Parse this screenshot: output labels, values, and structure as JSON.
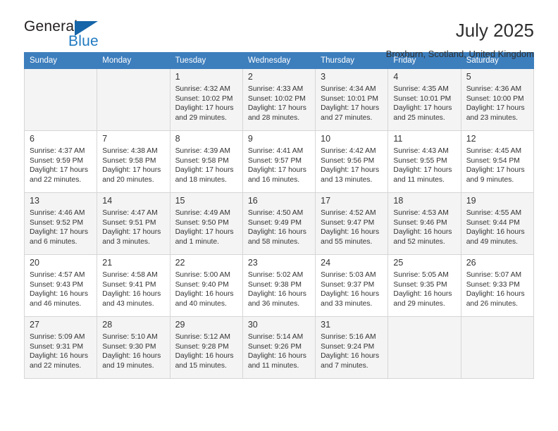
{
  "brand": {
    "name_top": "General",
    "name_bottom": "Blue",
    "triangle_color": "#1565a8",
    "blue_text_color": "#1f7ac0"
  },
  "header": {
    "title": "July 2025",
    "location": "Broxburn, Scotland, United Kingdom"
  },
  "theme": {
    "header_row_bg": "#3d7ebd",
    "header_row_text": "#ffffff",
    "alt_row_bg": "#f4f4f4",
    "cell_border": "#d6d6d6"
  },
  "weekdays": [
    "Sunday",
    "Monday",
    "Tuesday",
    "Wednesday",
    "Thursday",
    "Friday",
    "Saturday"
  ],
  "labels": {
    "sunrise": "Sunrise:",
    "sunset": "Sunset:",
    "daylight": "Daylight:"
  },
  "weeks": [
    [
      {
        "day": "",
        "empty": true
      },
      {
        "day": "",
        "empty": true
      },
      {
        "day": "1",
        "sunrise": "Sunrise: 4:32 AM",
        "sunset": "Sunset: 10:02 PM",
        "daylight_1": "Daylight: 17 hours",
        "daylight_2": "and 29 minutes."
      },
      {
        "day": "2",
        "sunrise": "Sunrise: 4:33 AM",
        "sunset": "Sunset: 10:02 PM",
        "daylight_1": "Daylight: 17 hours",
        "daylight_2": "and 28 minutes."
      },
      {
        "day": "3",
        "sunrise": "Sunrise: 4:34 AM",
        "sunset": "Sunset: 10:01 PM",
        "daylight_1": "Daylight: 17 hours",
        "daylight_2": "and 27 minutes."
      },
      {
        "day": "4",
        "sunrise": "Sunrise: 4:35 AM",
        "sunset": "Sunset: 10:01 PM",
        "daylight_1": "Daylight: 17 hours",
        "daylight_2": "and 25 minutes."
      },
      {
        "day": "5",
        "sunrise": "Sunrise: 4:36 AM",
        "sunset": "Sunset: 10:00 PM",
        "daylight_1": "Daylight: 17 hours",
        "daylight_2": "and 23 minutes."
      }
    ],
    [
      {
        "day": "6",
        "sunrise": "Sunrise: 4:37 AM",
        "sunset": "Sunset: 9:59 PM",
        "daylight_1": "Daylight: 17 hours",
        "daylight_2": "and 22 minutes."
      },
      {
        "day": "7",
        "sunrise": "Sunrise: 4:38 AM",
        "sunset": "Sunset: 9:58 PM",
        "daylight_1": "Daylight: 17 hours",
        "daylight_2": "and 20 minutes."
      },
      {
        "day": "8",
        "sunrise": "Sunrise: 4:39 AM",
        "sunset": "Sunset: 9:58 PM",
        "daylight_1": "Daylight: 17 hours",
        "daylight_2": "and 18 minutes."
      },
      {
        "day": "9",
        "sunrise": "Sunrise: 4:41 AM",
        "sunset": "Sunset: 9:57 PM",
        "daylight_1": "Daylight: 17 hours",
        "daylight_2": "and 16 minutes."
      },
      {
        "day": "10",
        "sunrise": "Sunrise: 4:42 AM",
        "sunset": "Sunset: 9:56 PM",
        "daylight_1": "Daylight: 17 hours",
        "daylight_2": "and 13 minutes."
      },
      {
        "day": "11",
        "sunrise": "Sunrise: 4:43 AM",
        "sunset": "Sunset: 9:55 PM",
        "daylight_1": "Daylight: 17 hours",
        "daylight_2": "and 11 minutes."
      },
      {
        "day": "12",
        "sunrise": "Sunrise: 4:45 AM",
        "sunset": "Sunset: 9:54 PM",
        "daylight_1": "Daylight: 17 hours",
        "daylight_2": "and 9 minutes."
      }
    ],
    [
      {
        "day": "13",
        "sunrise": "Sunrise: 4:46 AM",
        "sunset": "Sunset: 9:52 PM",
        "daylight_1": "Daylight: 17 hours",
        "daylight_2": "and 6 minutes."
      },
      {
        "day": "14",
        "sunrise": "Sunrise: 4:47 AM",
        "sunset": "Sunset: 9:51 PM",
        "daylight_1": "Daylight: 17 hours",
        "daylight_2": "and 3 minutes."
      },
      {
        "day": "15",
        "sunrise": "Sunrise: 4:49 AM",
        "sunset": "Sunset: 9:50 PM",
        "daylight_1": "Daylight: 17 hours",
        "daylight_2": "and 1 minute."
      },
      {
        "day": "16",
        "sunrise": "Sunrise: 4:50 AM",
        "sunset": "Sunset: 9:49 PM",
        "daylight_1": "Daylight: 16 hours",
        "daylight_2": "and 58 minutes."
      },
      {
        "day": "17",
        "sunrise": "Sunrise: 4:52 AM",
        "sunset": "Sunset: 9:47 PM",
        "daylight_1": "Daylight: 16 hours",
        "daylight_2": "and 55 minutes."
      },
      {
        "day": "18",
        "sunrise": "Sunrise: 4:53 AM",
        "sunset": "Sunset: 9:46 PM",
        "daylight_1": "Daylight: 16 hours",
        "daylight_2": "and 52 minutes."
      },
      {
        "day": "19",
        "sunrise": "Sunrise: 4:55 AM",
        "sunset": "Sunset: 9:44 PM",
        "daylight_1": "Daylight: 16 hours",
        "daylight_2": "and 49 minutes."
      }
    ],
    [
      {
        "day": "20",
        "sunrise": "Sunrise: 4:57 AM",
        "sunset": "Sunset: 9:43 PM",
        "daylight_1": "Daylight: 16 hours",
        "daylight_2": "and 46 minutes."
      },
      {
        "day": "21",
        "sunrise": "Sunrise: 4:58 AM",
        "sunset": "Sunset: 9:41 PM",
        "daylight_1": "Daylight: 16 hours",
        "daylight_2": "and 43 minutes."
      },
      {
        "day": "22",
        "sunrise": "Sunrise: 5:00 AM",
        "sunset": "Sunset: 9:40 PM",
        "daylight_1": "Daylight: 16 hours",
        "daylight_2": "and 40 minutes."
      },
      {
        "day": "23",
        "sunrise": "Sunrise: 5:02 AM",
        "sunset": "Sunset: 9:38 PM",
        "daylight_1": "Daylight: 16 hours",
        "daylight_2": "and 36 minutes."
      },
      {
        "day": "24",
        "sunrise": "Sunrise: 5:03 AM",
        "sunset": "Sunset: 9:37 PM",
        "daylight_1": "Daylight: 16 hours",
        "daylight_2": "and 33 minutes."
      },
      {
        "day": "25",
        "sunrise": "Sunrise: 5:05 AM",
        "sunset": "Sunset: 9:35 PM",
        "daylight_1": "Daylight: 16 hours",
        "daylight_2": "and 29 minutes."
      },
      {
        "day": "26",
        "sunrise": "Sunrise: 5:07 AM",
        "sunset": "Sunset: 9:33 PM",
        "daylight_1": "Daylight: 16 hours",
        "daylight_2": "and 26 minutes."
      }
    ],
    [
      {
        "day": "27",
        "sunrise": "Sunrise: 5:09 AM",
        "sunset": "Sunset: 9:31 PM",
        "daylight_1": "Daylight: 16 hours",
        "daylight_2": "and 22 minutes."
      },
      {
        "day": "28",
        "sunrise": "Sunrise: 5:10 AM",
        "sunset": "Sunset: 9:30 PM",
        "daylight_1": "Daylight: 16 hours",
        "daylight_2": "and 19 minutes."
      },
      {
        "day": "29",
        "sunrise": "Sunrise: 5:12 AM",
        "sunset": "Sunset: 9:28 PM",
        "daylight_1": "Daylight: 16 hours",
        "daylight_2": "and 15 minutes."
      },
      {
        "day": "30",
        "sunrise": "Sunrise: 5:14 AM",
        "sunset": "Sunset: 9:26 PM",
        "daylight_1": "Daylight: 16 hours",
        "daylight_2": "and 11 minutes."
      },
      {
        "day": "31",
        "sunrise": "Sunrise: 5:16 AM",
        "sunset": "Sunset: 9:24 PM",
        "daylight_1": "Daylight: 16 hours",
        "daylight_2": "and 7 minutes."
      },
      {
        "day": "",
        "empty": true
      },
      {
        "day": "",
        "empty": true
      }
    ]
  ]
}
